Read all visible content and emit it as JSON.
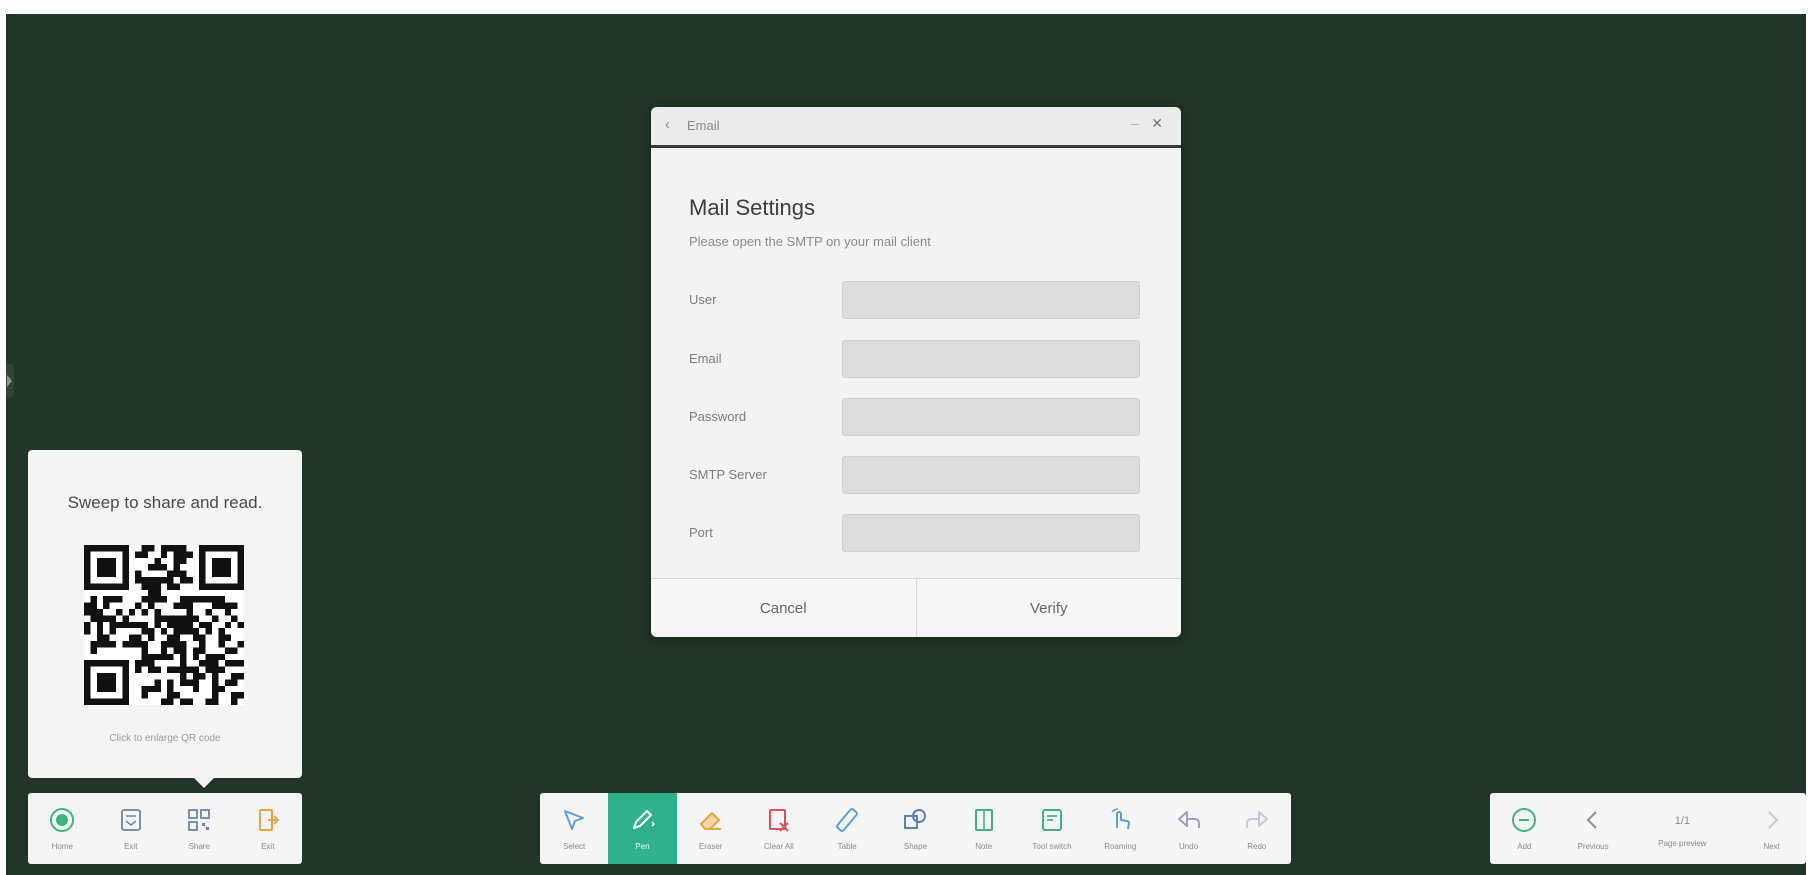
{
  "dialog": {
    "window_title": "Email",
    "heading": "Mail Settings",
    "subtitle": "Please open the SMTP on your mail client",
    "fields": [
      {
        "label": "User",
        "value": ""
      },
      {
        "label": "Email",
        "value": ""
      },
      {
        "label": "Password",
        "value": ""
      },
      {
        "label": "SMTP Server",
        "value": ""
      },
      {
        "label": "Port",
        "value": ""
      }
    ],
    "cancel_label": "Cancel",
    "verify_label": "Verify"
  },
  "qr_popup": {
    "title": "Sweep to share and read.",
    "hint": "Click to enlarge QR code"
  },
  "left_toolbar": [
    {
      "label": "Home",
      "icon": "home-icon"
    },
    {
      "label": "Exit",
      "icon": "exit-icon"
    },
    {
      "label": "Share",
      "icon": "qr-share-icon"
    },
    {
      "label": "Exit",
      "icon": "exit-board-icon"
    }
  ],
  "center_toolbar": [
    {
      "label": "Select",
      "icon": "select-icon"
    },
    {
      "label": "Pen",
      "icon": "pen-icon",
      "active": true
    },
    {
      "label": "Eraser",
      "icon": "eraser-icon"
    },
    {
      "label": "Clear All",
      "icon": "clear-all-icon"
    },
    {
      "label": "Table",
      "icon": "ruler-icon"
    },
    {
      "label": "Shape",
      "icon": "shape-icon"
    },
    {
      "label": "Note",
      "icon": "note-icon"
    },
    {
      "label": "Tool switch",
      "icon": "tool-switch-icon"
    },
    {
      "label": "Roaming",
      "icon": "roaming-icon"
    },
    {
      "label": "Undo",
      "icon": "undo-icon"
    },
    {
      "label": "Redo",
      "icon": "redo-icon"
    }
  ],
  "right_toolbar": {
    "add_label": "Add",
    "prev_label": "Previous",
    "page_number": "1/1",
    "page_label": "Page preview",
    "next_label": "Next"
  },
  "colors": {
    "board": "#213528",
    "accent": "#2fb28b",
    "pen_active_bg": "#2fb28b",
    "eraser": "#e8a640",
    "clear": "#e0505a",
    "icon_blue": "#5aa0e0",
    "icon_green": "#3fb37f"
  }
}
